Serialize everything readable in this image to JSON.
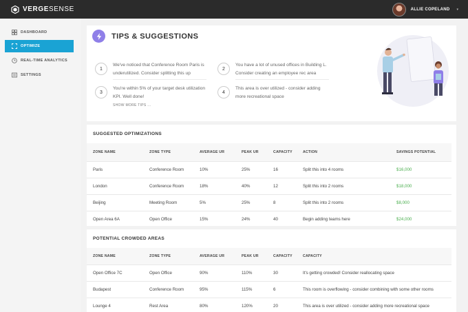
{
  "brand": {
    "name_bold": "VERGE",
    "name_thin": "SENSE"
  },
  "user": {
    "name": "ALLIE COPELAND",
    "caret": "▾"
  },
  "sidebar": {
    "items": [
      {
        "label": "DASHBOARD",
        "icon": "dashboard-icon",
        "active": false
      },
      {
        "label": "OPTIMIZE",
        "icon": "optimize-icon",
        "active": true
      },
      {
        "label": "REAL-TIME ANALYTICS",
        "icon": "clock-icon",
        "active": false
      },
      {
        "label": "SETTINGS",
        "icon": "settings-icon",
        "active": false
      }
    ]
  },
  "tips": {
    "title": "TIPS & SUGGESTIONS",
    "items": [
      {
        "num": "1",
        "text": "We've noticed that Conference Room Paris is underutilized. Consider splitting this up"
      },
      {
        "num": "2",
        "text": "You have a lot of unused offices in Building L. Consider creating an employee rec area"
      },
      {
        "num": "3",
        "text": "You're within 5% of your target desk utilization KPI. Well done!"
      },
      {
        "num": "4",
        "text": "This area is over utilized - consider adding more recreational space"
      }
    ],
    "show_more": "SHOW MORE TIPS ..."
  },
  "optimizations": {
    "title": "SUGGESTED OPTIMIZATIONS",
    "columns": [
      "ZONE NAME",
      "ZONE TYPE",
      "AVERAGE UR",
      "PEAK UR",
      "CAPACITY",
      "ACTION",
      "SAVINGS POTENTIAL"
    ],
    "rows": [
      [
        "Paris",
        "Conference Room",
        "10%",
        "25%",
        "16",
        "Split this into 4 rooms",
        "$16,000"
      ],
      [
        "London",
        "Conference Room",
        "18%",
        "40%",
        "12",
        "Split this into 2 rooms",
        "$18,000"
      ],
      [
        "Beijing",
        "Meeting Room",
        "5%",
        "25%",
        "8",
        "Split this into 2 rooms",
        "$8,000"
      ],
      [
        "Open Area 6A",
        "Open Office",
        "15%",
        "24%",
        "40",
        "Begin adding teams here",
        "$24,000"
      ]
    ]
  },
  "crowded": {
    "title": "POTENTIAL CROWDED AREAS",
    "columns": [
      "ZONE NAME",
      "ZONE TYPE",
      "AVERAGE UR",
      "PEAK UR",
      "CAPACITY",
      "CAPACITY"
    ],
    "rows": [
      [
        "Open Office 7C",
        "Open Office",
        "90%",
        "110%",
        "30",
        "It's getting crowded! Consider reallocating space"
      ],
      [
        "Budapest",
        "Conference Room",
        "95%",
        "115%",
        "6",
        "This room is overflowing - consider combining with some other rooms"
      ],
      [
        "Lounge 4",
        "Rest Area",
        "80%",
        "120%",
        "20",
        "This area is over utilized - consider adding more recreational space"
      ]
    ]
  },
  "colors": {
    "accent": "#1aa3d4",
    "bolt": "#8f7fe8",
    "money": "#4caf50",
    "topbar": "#2b2b2b"
  }
}
